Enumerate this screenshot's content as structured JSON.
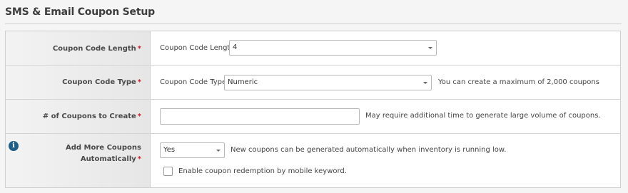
{
  "page": {
    "title": "SMS & Email Coupon Setup"
  },
  "rows": {
    "code_length": {
      "label": "Coupon Code Length",
      "required": "*",
      "inline_label": "Coupon Code Length",
      "select_value": "4"
    },
    "code_type": {
      "label": "Coupon Code Type",
      "required": "*",
      "inline_label": "Coupon Code Type",
      "select_value": "Numeric",
      "hint": "You can create a maximum of 2,000 coupons"
    },
    "num_coupons": {
      "label": "# of Coupons to Create",
      "required": "*",
      "input_value": "",
      "hint": "May require additional time to generate large volume of coupons."
    },
    "add_more": {
      "label_line1": "Add More Coupons",
      "label_line2": "Automatically",
      "required": "*",
      "select_value": "Yes",
      "hint": "New coupons can be generated automatically when inventory is running low.",
      "checkbox_label": "Enable coupon redemption by mobile keyword.",
      "checkbox_checked": false,
      "icon": "info-icon"
    }
  },
  "colors": {
    "required": "#d0202a",
    "info_icon": "#1f5e86"
  }
}
